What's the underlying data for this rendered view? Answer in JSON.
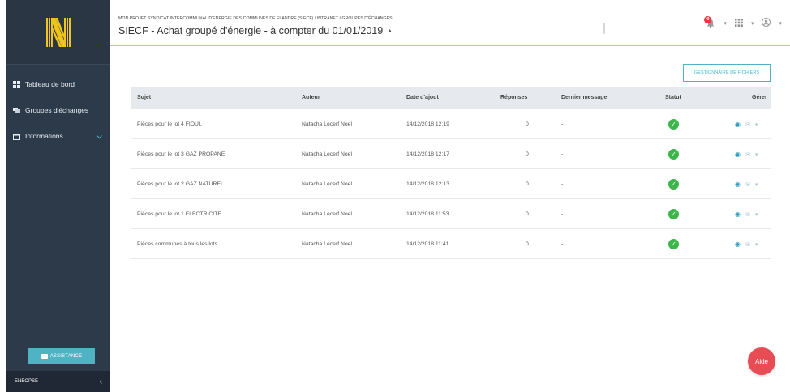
{
  "colors": {
    "sidebar": "#2d3a4a",
    "accent": "#4fb3c4",
    "brand_yellow": "#f0c419",
    "ok": "#3cb64a",
    "aide": "#e84c55"
  },
  "sidebar": {
    "items": [
      {
        "label": "Tableau de bord",
        "icon": "dashboard-icon"
      },
      {
        "label": "Groupes d'échanges",
        "icon": "chat-icon"
      },
      {
        "label": "Informations",
        "icon": "calendar-icon"
      }
    ],
    "assistance_label": "ASSISTANCE",
    "footer_label": "ENEOPSE",
    "collapse_icon": "chevron-left-icon"
  },
  "header": {
    "breadcrumb": "MON PROJET SYNDICAT INTERCOMMUNAL D'ENERGIE DES COMMUNES DE FLANDRE (SIECF) / INTRANET / GROUPES D'ÉCHANGES",
    "title": "SIECF - Achat groupé d'énergie - à compter du 01/01/2019",
    "notification_count": "0"
  },
  "files_button_label": "GESTIONNAIRE DE FICHIERS",
  "table": {
    "columns": [
      "Sujet",
      "Auteur",
      "Date d'ajout",
      "Réponses",
      "Dernier message",
      "Statut",
      "Gérer"
    ],
    "rows": [
      {
        "sujet": "Pièces pour le lot 4 FIOUL",
        "auteur": "Natacha Lecerf Noel",
        "date": "14/12/2018 12:19",
        "reponses": "0",
        "dernier": "-"
      },
      {
        "sujet": "Pièces pour le lot 3 GAZ PROPANE",
        "auteur": "Natacha Lecerf Noel",
        "date": "14/12/2018 12:17",
        "reponses": "0",
        "dernier": "-"
      },
      {
        "sujet": "Pièces pour le lot 2 GAZ NATUREL",
        "auteur": "Natacha Lecerf Noel",
        "date": "14/12/2018 12:13",
        "reponses": "0",
        "dernier": "-"
      },
      {
        "sujet": "Pièces pour le lot 1 ELECTRICITE",
        "auteur": "Natacha Lecerf Noel",
        "date": "14/12/2018 11:53",
        "reponses": "0",
        "dernier": "-"
      },
      {
        "sujet": "Pièces communes à tous les lots",
        "auteur": "Natacha Lecerf Noel",
        "date": "14/12/2018 11:41",
        "reponses": "0",
        "dernier": "-"
      }
    ]
  },
  "aide_label": "Aide"
}
